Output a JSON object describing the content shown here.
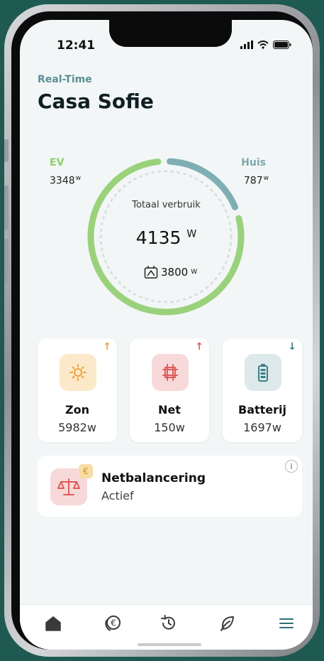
{
  "status": {
    "time": "12:41"
  },
  "header": {
    "eyebrow": "Real-Time",
    "title": "Casa Sofie"
  },
  "gauge": {
    "ev_label": "EV",
    "ev_value": "3348",
    "ev_unit": "w",
    "huis_label": "Huis",
    "huis_value": "787",
    "huis_unit": "w",
    "total_label": "Totaal verbruik",
    "total_value": "4135",
    "total_unit": "W",
    "solar_value": "3800",
    "solar_unit": "W",
    "ev_share": 0.81,
    "huis_share": 0.19,
    "colors": {
      "ev": "#9ad27c",
      "huis": "#7faeb3"
    }
  },
  "cards": [
    {
      "name": "Zon",
      "value": "5982w",
      "arrow": "↑",
      "arrow_color": "#f0a43a",
      "tile_color": "#fbe9c9",
      "icon": "sun-icon"
    },
    {
      "name": "Net",
      "value": "150w",
      "arrow": "↑",
      "arrow_color": "#e05a5a",
      "tile_color": "#f8d9d9",
      "icon": "grid-icon"
    },
    {
      "name": "Batterij",
      "value": "1697w",
      "arrow": "↓",
      "arrow_color": "#3f7f87",
      "tile_color": "#dde9ea",
      "icon": "battery-icon"
    }
  ],
  "balancing": {
    "name": "Netbalancering",
    "state": "Actief",
    "coin": "€",
    "info": "i",
    "icon": "scale-icon"
  },
  "tabs": [
    "home-icon",
    "euro-coins-icon",
    "history-icon",
    "leaf-icon",
    "menu-icon"
  ]
}
